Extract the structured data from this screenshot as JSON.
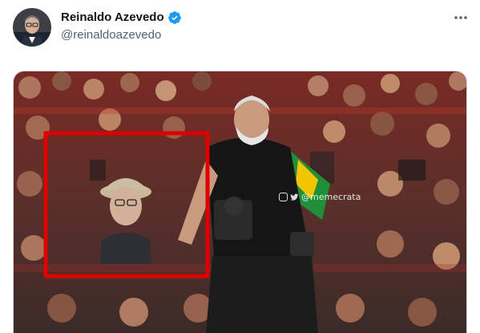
{
  "tweet": {
    "author": {
      "display_name": "Reinaldo Azevedo",
      "handle": "@reinaldoazevedo",
      "verified": true
    },
    "more_icon": "more-horizontal-icon",
    "media": {
      "watermark": "@memecrata",
      "highlight_color": "#e00000"
    }
  },
  "colors": {
    "text_primary": "#0f1419",
    "text_secondary": "#536471",
    "verified_blue": "#1d9bf0",
    "border": "#cfd9de"
  }
}
